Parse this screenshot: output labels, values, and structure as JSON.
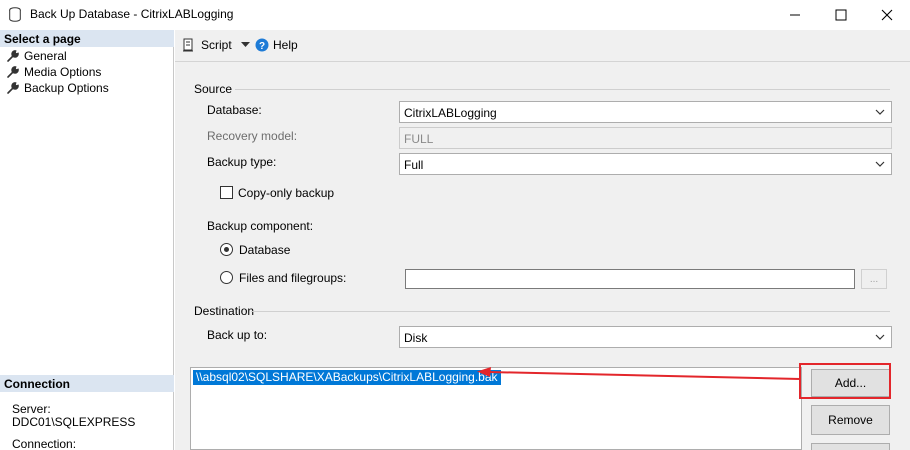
{
  "window": {
    "title": "Back Up Database - CitrixLABLogging"
  },
  "left_panel": {
    "select_page_header": "Select a page",
    "pages": [
      {
        "label": "General"
      },
      {
        "label": "Media Options"
      },
      {
        "label": "Backup Options"
      }
    ],
    "connection_header": "Connection",
    "server_label": "Server:",
    "server_value": "DDC01\\SQLEXPRESS",
    "connection_label": "Connection:"
  },
  "toolbar": {
    "script_label": "Script",
    "help_label": "Help"
  },
  "source": {
    "group_label": "Source",
    "database_label": "Database:",
    "database_value": "CitrixLABLogging",
    "recovery_label": "Recovery model:",
    "recovery_value": "FULL",
    "backup_type_label": "Backup type:",
    "backup_type_value": "Full",
    "copy_only_label": "Copy-only backup",
    "component_label": "Backup component:",
    "radio_database_label": "Database",
    "radio_files_label": "Files and filegroups:",
    "browse_label": "..."
  },
  "destination": {
    "group_label": "Destination",
    "backup_to_label": "Back up to:",
    "backup_to_value": "Disk",
    "paths": [
      "\\\\absql02\\SQLSHARE\\XABackups\\CitrixLABLogging.bak"
    ],
    "add_label": "Add...",
    "remove_label": "Remove"
  },
  "colors": {
    "selection": "#0078d7",
    "annotation": "#e3262b",
    "section_header_bg": "#dbe5f1"
  }
}
